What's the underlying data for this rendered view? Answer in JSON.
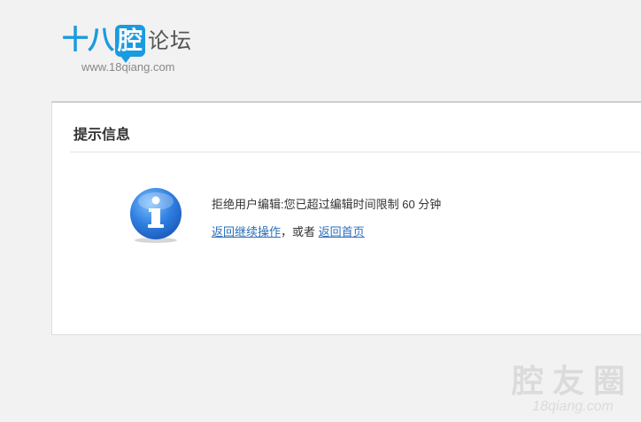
{
  "header": {
    "logo_text_blue": "十八",
    "logo_text_bubble": "腔",
    "logo_text_gray": "论坛",
    "logo_url": "www.18qiang.com"
  },
  "message_panel": {
    "title": "提示信息",
    "message": "拒绝用户编辑:您已超过编辑时间限制 60 分钟",
    "link_continue": "返回继续操作",
    "separator": "，或者",
    "link_home": "返回首页",
    "icon": "info-icon"
  },
  "watermark": {
    "text": "腔友圈",
    "url": "18qiang.com"
  },
  "colors": {
    "brand_blue": "#1a9be0",
    "link": "#2a6ebb",
    "background": "#f2f2f2"
  }
}
